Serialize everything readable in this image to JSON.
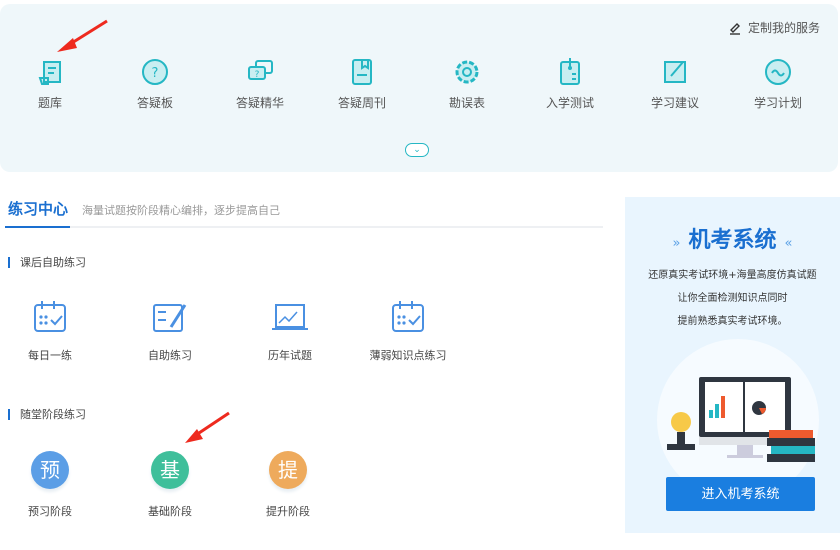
{
  "services": {
    "customize": "定制我的服务",
    "items": [
      {
        "label": "题库",
        "icon": "scroll-icon"
      },
      {
        "label": "答疑板",
        "icon": "question-bubble-icon"
      },
      {
        "label": "答疑精华",
        "icon": "double-bubble-icon"
      },
      {
        "label": "答疑周刊",
        "icon": "bookmark-book-icon"
      },
      {
        "label": "勘误表",
        "icon": "gear-icon"
      },
      {
        "label": "入学测试",
        "icon": "clipboard-icon"
      },
      {
        "label": "学习建议",
        "icon": "edit-square-icon"
      },
      {
        "label": "学习计划",
        "icon": "wave-circle-icon"
      }
    ]
  },
  "practice": {
    "title": "练习中心",
    "subtitle": "海量试题按阶段精心编排，逐步提高自己",
    "section1": {
      "title": "课后自助练习",
      "items": [
        {
          "label": "每日一练"
        },
        {
          "label": "自助练习"
        },
        {
          "label": "历年试题"
        },
        {
          "label": "薄弱知识点练习"
        }
      ]
    },
    "section2": {
      "title": "随堂阶段练习",
      "items": [
        {
          "char": "预",
          "label": "预习阶段",
          "color": "#5b9ee6"
        },
        {
          "char": "基",
          "label": "基础阶段",
          "color": "#3fbf9b"
        },
        {
          "char": "提",
          "label": "提升阶段",
          "color": "#eeaa5c"
        }
      ]
    }
  },
  "exam": {
    "title": "机考系统",
    "left_deco": "»",
    "right_deco": "«",
    "lines": [
      "还原真实考试环境+海量高度仿真试题",
      "让你全面检测知识点同时",
      "提前熟悉真实考试环境。"
    ],
    "button": "进入机考系统"
  }
}
